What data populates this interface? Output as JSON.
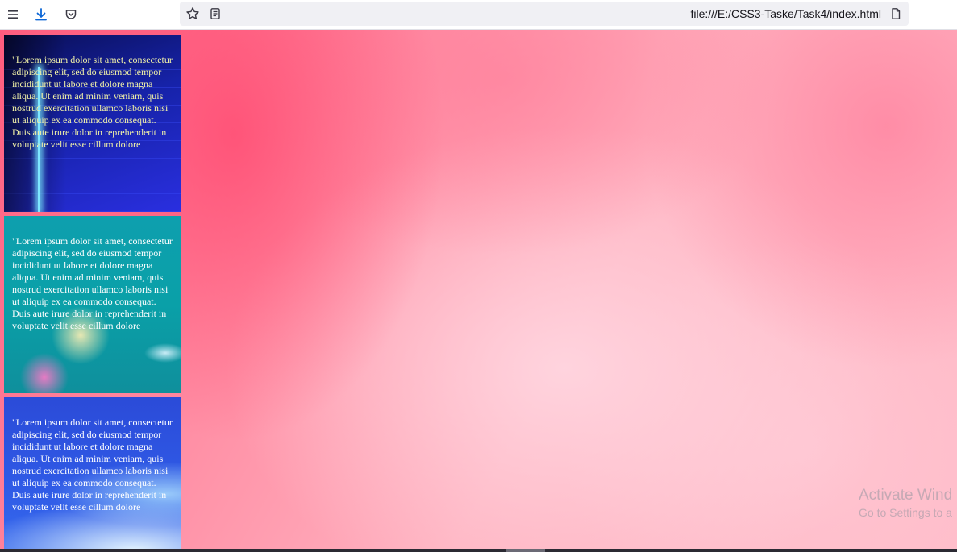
{
  "browser": {
    "toolbar_icons": [
      "menu-icon",
      "download-icon",
      "pocket-icon"
    ],
    "url": "file:///E:/CSS3-Taske/Task4/index.html",
    "url_icons": [
      "star-icon",
      "reader-view-icon",
      "page-icon"
    ],
    "accent": "#0b66d6"
  },
  "cards": [
    {
      "text": "\"Lorem ipsum dolor sit amet, consectetur adipiscing elit, sed do eiusmod tempor incididunt ut labore et dolore magna aliqua. Ut enim ad minim veniam, quis nostrud exercitation ullamco laboris nisi ut aliquip ex ea commodo consequat. Duis aute irure dolor in reprehenderit in voluptate velit esse cillum dolore"
    },
    {
      "text": "\"Lorem ipsum dolor sit amet, consectetur adipiscing elit, sed do eiusmod tempor incididunt ut labore et dolore magna aliqua. Ut enim ad minim veniam, quis nostrud exercitation ullamco laboris nisi ut aliquip ex ea commodo consequat. Duis aute irure dolor in reprehenderit in voluptate velit esse cillum dolore"
    },
    {
      "text": "\"Lorem ipsum dolor sit amet, consectetur adipiscing elit, sed do eiusmod tempor incididunt ut labore et dolore magna aliqua. Ut enim ad minim veniam, quis nostrud exercitation ullamco laboris nisi ut aliquip ex ea commodo consequat. Duis aute irure dolor in reprehenderit in voluptate velit esse cillum dolore"
    }
  ],
  "watermark": {
    "title": "Activate Wind",
    "subtitle": "Go to Settings to a"
  }
}
